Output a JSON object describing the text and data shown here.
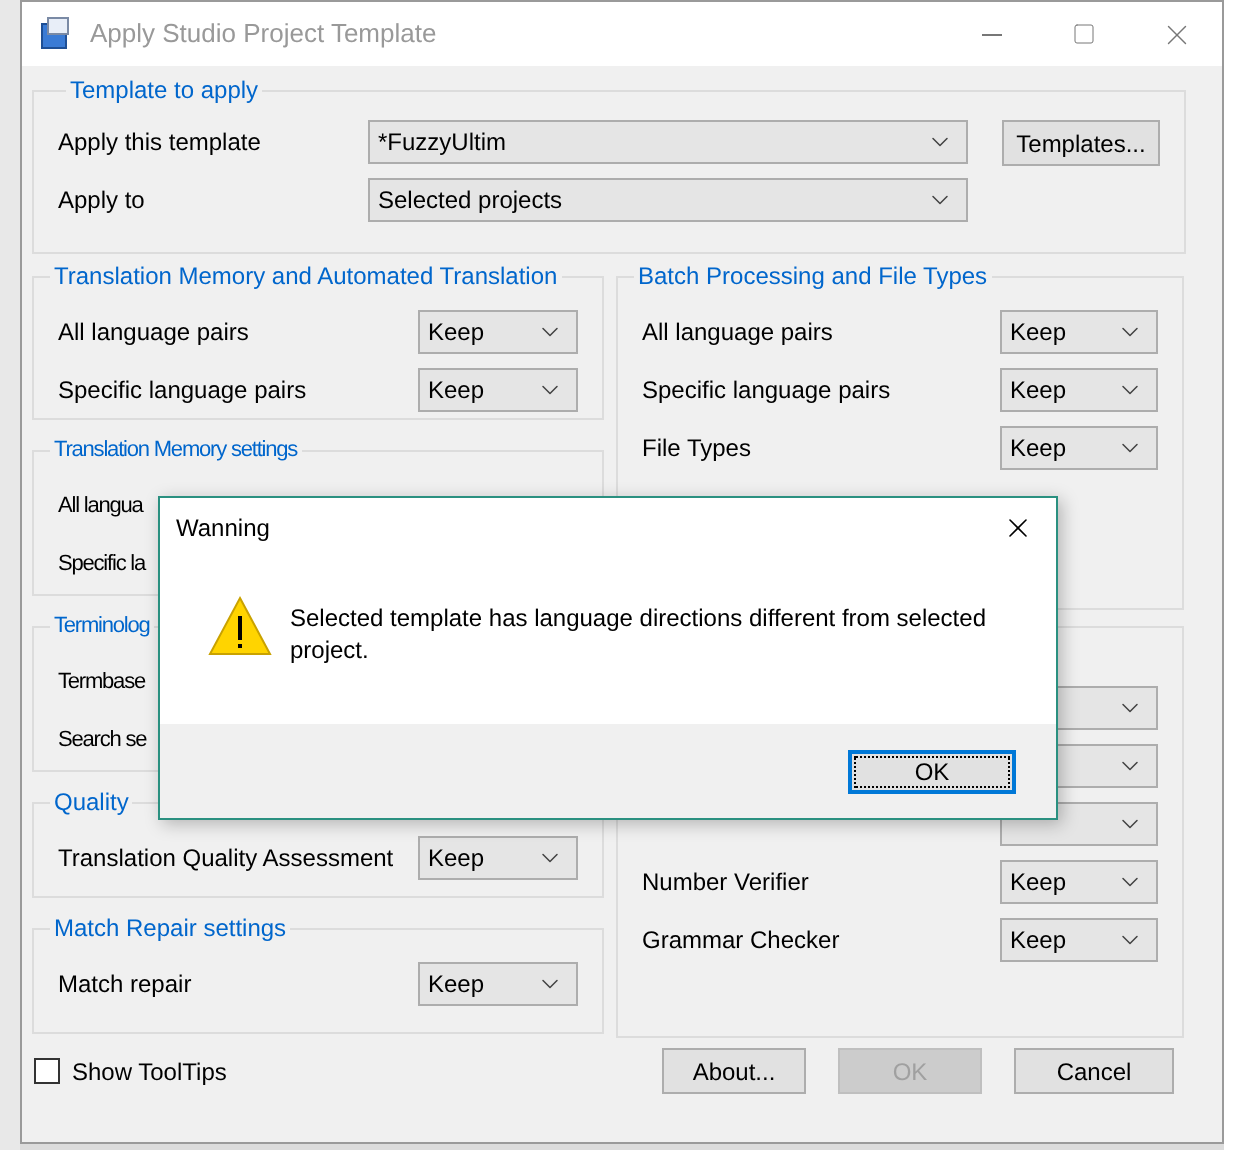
{
  "window": {
    "title": "Apply Studio Project Template"
  },
  "template_group": {
    "title": "Template to apply",
    "rows": [
      {
        "label": "Apply this template",
        "value": "*FuzzyUltim"
      },
      {
        "label": "Apply to",
        "value": "Selected projects"
      }
    ],
    "templates_button": "Templates..."
  },
  "left_groups": [
    {
      "title": "Translation Memory and Automated Translation",
      "rows": [
        {
          "kind": "combo",
          "label": "All language pairs",
          "value": "Keep"
        },
        {
          "kind": "combo",
          "label": "Specific language pairs",
          "value": "Keep"
        }
      ]
    },
    {
      "title": "Translation Memory settings",
      "rows": [
        {
          "kind": "covered",
          "label": "All langua"
        },
        {
          "kind": "covered",
          "label": "Specific la"
        }
      ]
    },
    {
      "title": "Terminolog",
      "rows": [
        {
          "kind": "covered",
          "label": "Termbase"
        },
        {
          "kind": "covered",
          "label": "Search se"
        }
      ]
    },
    {
      "title": "Quality",
      "rows": [
        {
          "kind": "combo",
          "label": "Translation Quality Assessment",
          "value": "Keep"
        }
      ]
    },
    {
      "title": "Match Repair settings",
      "rows": [
        {
          "kind": "combo",
          "label": "Match repair",
          "value": "Keep"
        }
      ]
    }
  ],
  "right_groups": [
    {
      "title": "Batch Processing and File Types",
      "rows": [
        {
          "kind": "combo",
          "label": "All language pairs",
          "value": "Keep"
        },
        {
          "kind": "combo",
          "label": "Specific language pairs",
          "value": "Keep"
        },
        {
          "kind": "combo",
          "label": "File Types",
          "value": "Keep"
        }
      ]
    },
    {
      "rows": [
        {
          "kind": "covered_combo"
        },
        {
          "kind": "covered_combo"
        },
        {
          "kind": "covered_combo"
        },
        {
          "kind": "combo",
          "label": "Number Verifier",
          "value": "Keep"
        },
        {
          "kind": "combo",
          "label": "Grammar Checker",
          "value": "Keep"
        }
      ]
    }
  ],
  "show_tooltips": {
    "label": "Show ToolTips",
    "checked": false
  },
  "buttons": [
    {
      "label": "About...",
      "disabled": false
    },
    {
      "label": "OK",
      "disabled": true
    },
    {
      "label": "Cancel",
      "disabled": false
    }
  ],
  "warning_dialog": {
    "title": "Wanning",
    "message": "Selected template has language directions different from selected project.",
    "ok": "OK"
  }
}
